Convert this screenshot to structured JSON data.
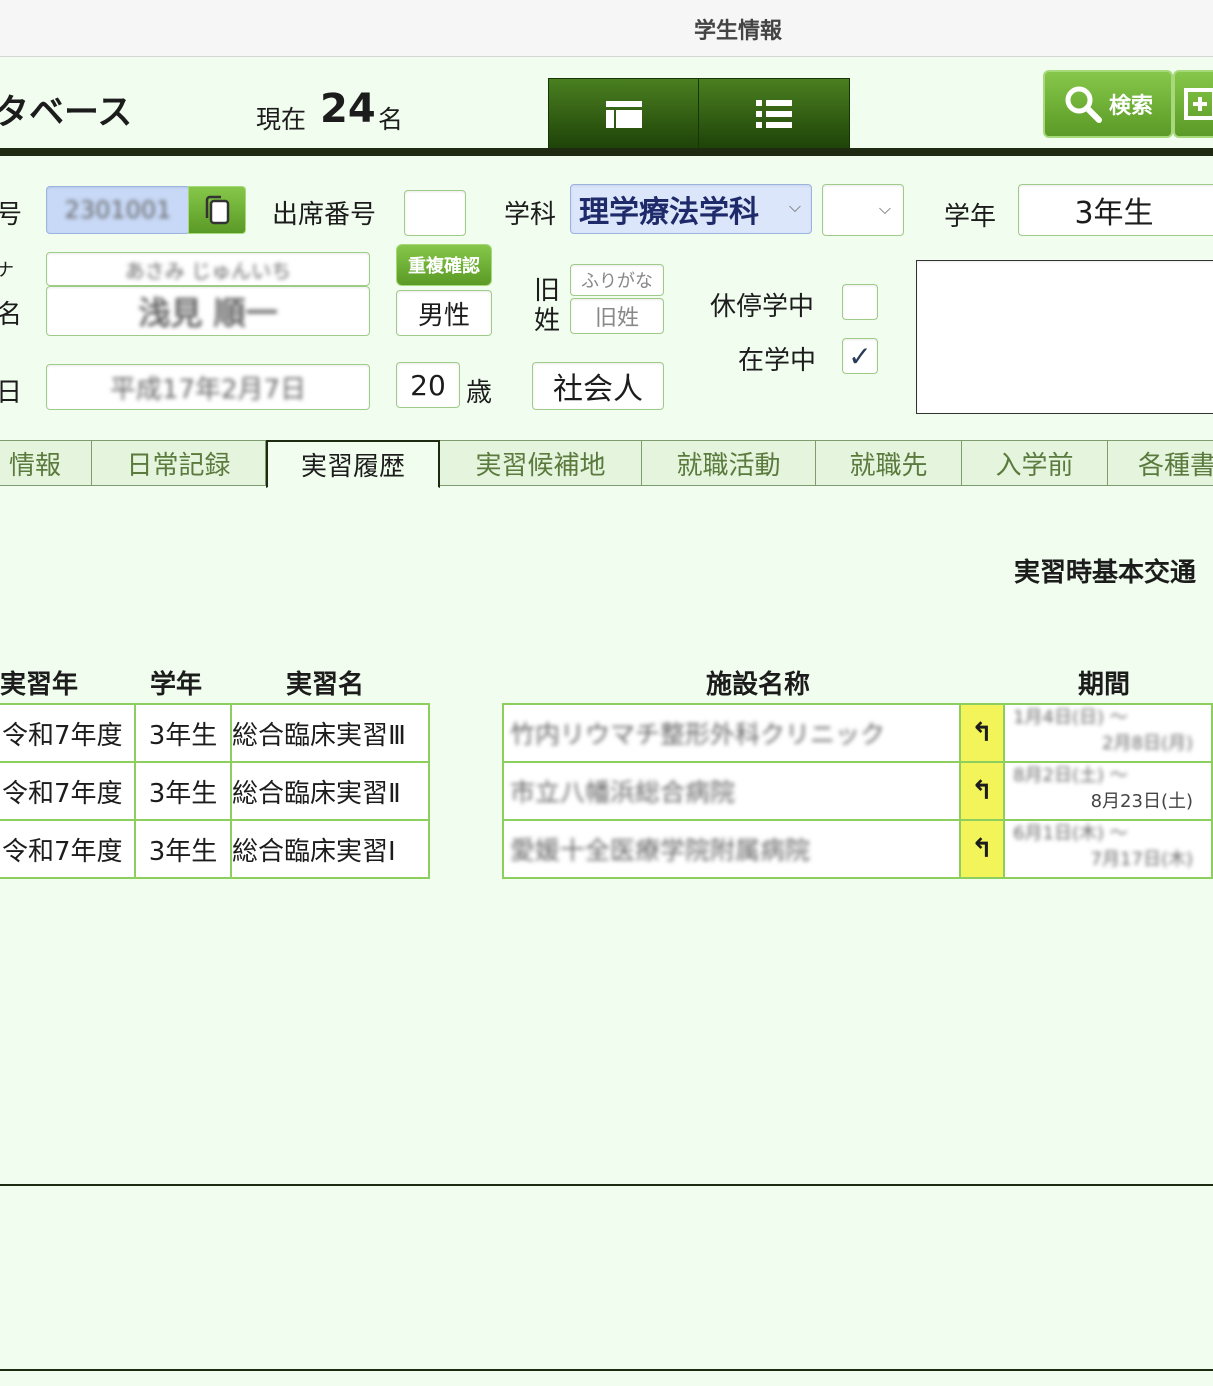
{
  "window": {
    "title": "学生情報"
  },
  "header": {
    "title": "タベース",
    "count_prefix": "現在",
    "count": "24",
    "count_suffix": "名",
    "search_label": "検索"
  },
  "form": {
    "id_label": "号",
    "id_value": "2301001",
    "attendance_label": "出席番号",
    "attendance_value": "",
    "department_label": "学科",
    "department_value": "理学療法学科",
    "department_sub_value": "",
    "grade_label": "学年",
    "grade_value": "3年生",
    "kana_label": "ナ",
    "kana_value": "あさみ じゅんいち",
    "name_label": "名",
    "name_value": "浅見 順一",
    "dup_check_label": "重複確認",
    "gender_value": "男性",
    "old_surname_label_1": "旧",
    "old_surname_label_2": "姓",
    "old_kana_placeholder": "ふりがな",
    "old_surname_placeholder": "旧姓",
    "leave_label": "休停学中",
    "leave_checked": false,
    "enrolled_label": "在学中",
    "enrolled_checked": true,
    "birth_label": "日",
    "birth_value": "平成17年2月7日",
    "age_value": "20",
    "age_unit": "歳",
    "status_value": "社会人",
    "notes": ""
  },
  "tabs": [
    {
      "label": "情報"
    },
    {
      "label": "日常記録"
    },
    {
      "label": "実習履歴",
      "active": true
    },
    {
      "label": "実習候補地"
    },
    {
      "label": "就職活動"
    },
    {
      "label": "就職先"
    },
    {
      "label": "入学前"
    },
    {
      "label": "各種書"
    }
  ],
  "practicum": {
    "transport_label": "実習時基本交通",
    "columns": [
      "実習年",
      "学年",
      "実習名",
      "施設名称",
      "期間"
    ],
    "rows": [
      {
        "year": "令和7年度",
        "grade": "3年生",
        "name": "総合臨床実習Ⅲ",
        "facility": "竹内リウマチ整形外科クリニック",
        "period_start": "1月4日(日)",
        "period_end": "2月8日(月)"
      },
      {
        "year": "令和7年度",
        "grade": "3年生",
        "name": "総合臨床実習Ⅱ",
        "facility": "市立八幡浜総合病院",
        "period_start": "8月2日(土)",
        "period_end": "8月23日(土)"
      },
      {
        "year": "令和7年度",
        "grade": "3年生",
        "name": "総合臨床実習Ⅰ",
        "facility": "愛媛十全医療学院附属病院",
        "period_start": "6月1日(木)",
        "period_end": "7月17日(木)"
      }
    ],
    "period_sep": "～",
    "jump_icon": "↰"
  }
}
